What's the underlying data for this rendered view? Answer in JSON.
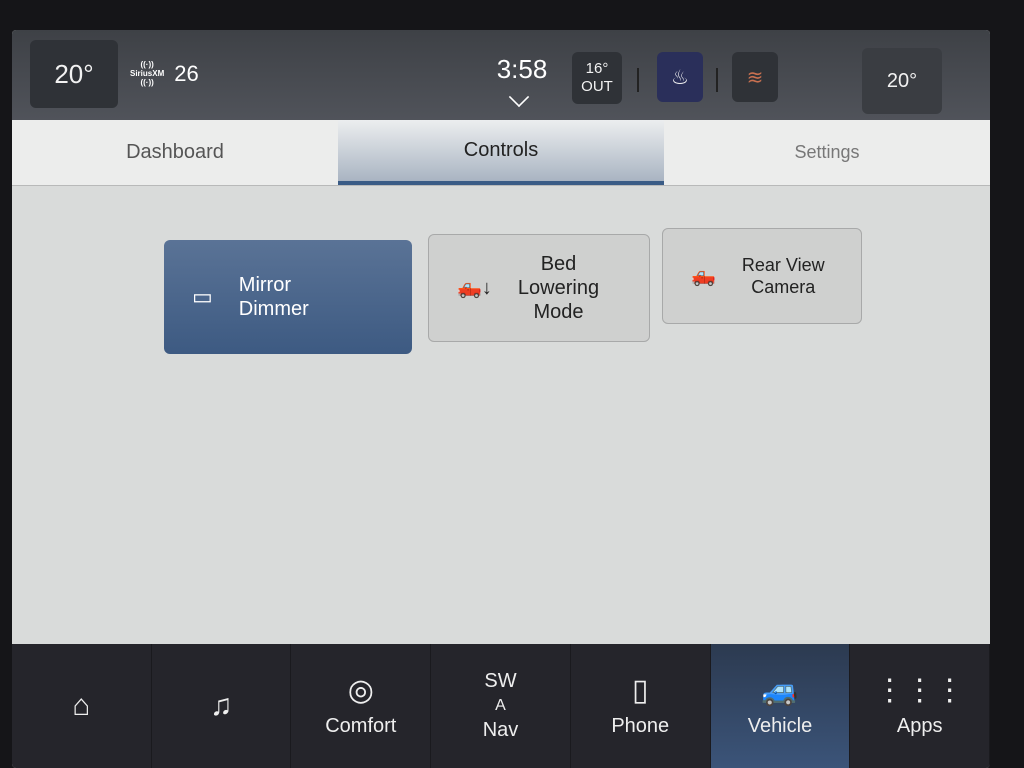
{
  "status_bar": {
    "driver_temp": "20°",
    "radio_brand": "SiriusXM",
    "radio_channel": "26",
    "clock": "3:58",
    "outside_temp": "16°",
    "outside_label": "OUT",
    "passenger_temp": "20°"
  },
  "tabs": [
    {
      "label": "Dashboard",
      "active": false
    },
    {
      "label": "Controls",
      "active": true
    },
    {
      "label": "Settings",
      "active": false
    }
  ],
  "controls": [
    {
      "label_line1": "Mirror",
      "label_line2": "Dimmer",
      "label_line3": "",
      "icon": "mirror-icon",
      "active": true
    },
    {
      "label_line1": "Bed",
      "label_line2": "Lowering",
      "label_line3": "Mode",
      "icon": "truck-lower-icon",
      "active": false
    },
    {
      "label_line1": "Rear View",
      "label_line2": "Camera",
      "label_line3": "",
      "icon": "truck-camera-icon",
      "active": false
    }
  ],
  "nav": {
    "home": "",
    "media": "",
    "comfort": "Comfort",
    "compass": "SW",
    "compass_arrow": "A",
    "nav_label": "Nav",
    "phone": "Phone",
    "vehicle": "Vehicle",
    "apps": "Apps"
  },
  "colors": {
    "active_accent": "#3d5a82",
    "topbar": "#45484d",
    "navbar": "#25252b"
  }
}
